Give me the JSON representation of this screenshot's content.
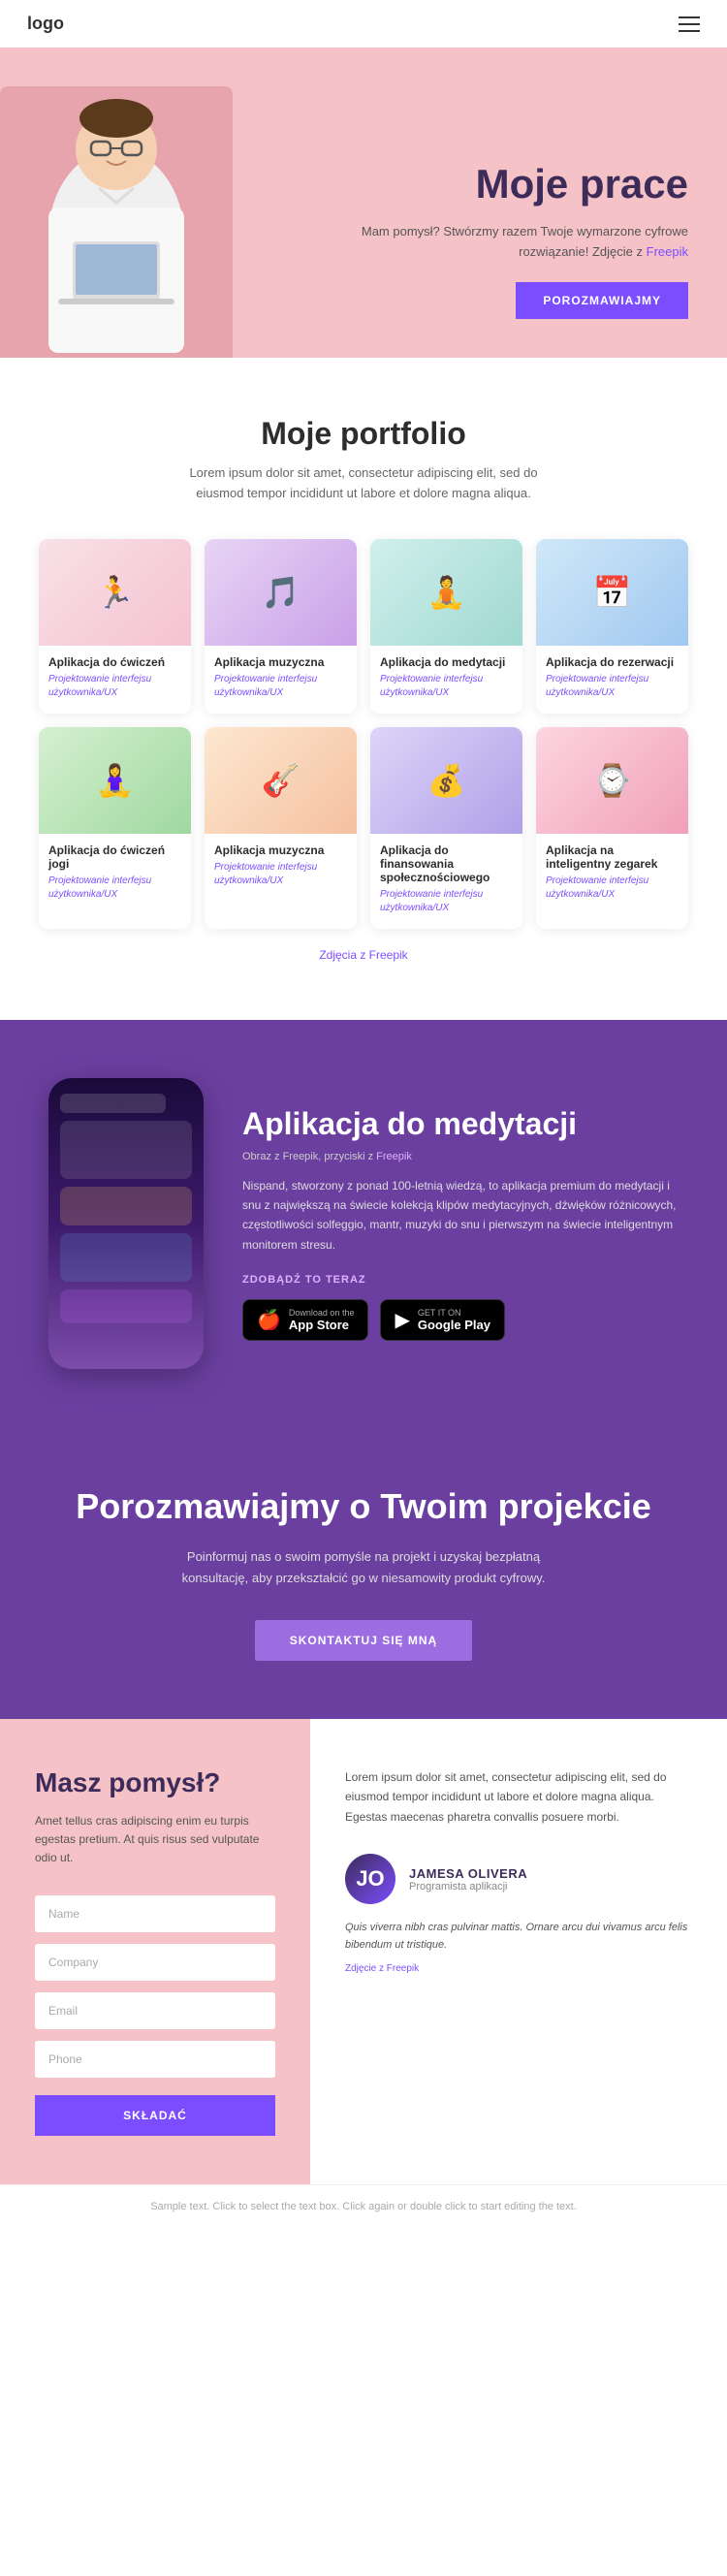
{
  "header": {
    "logo": "logo"
  },
  "hero": {
    "title": "Moje prace",
    "description": "Mam pomysł? Stwórzmy razem Twoje wymarzone cyfrowe rozwiązanie! Zdjęcie z",
    "freepik_link": "Freepik",
    "button_label": "POROZMAWIAJMY",
    "person_emoji": "👨‍💼"
  },
  "portfolio": {
    "title": "Moje portfolio",
    "description": "Lorem ipsum dolor sit amet, consectetur adipiscing elit, sed do eiusmod tempor incididunt ut labore et dolore magna aliqua.",
    "cards": [
      {
        "title": "Aplikacja do ćwiczeń",
        "subtitle": "Projektowanie interfejsu użytkownika/UX",
        "emoji": "🏃",
        "color_class": "card-pink"
      },
      {
        "title": "Aplikacja muzyczna",
        "subtitle": "Projektowanie interfejsu użytkownika/UX",
        "emoji": "🎵",
        "color_class": "card-purple"
      },
      {
        "title": "Aplikacja do medytacji",
        "subtitle": "Projektowanie interfejsu użytkownika/UX",
        "emoji": "🧘",
        "color_class": "card-teal"
      },
      {
        "title": "Aplikacja do rezerwacji",
        "subtitle": "Projektowanie interfejsu użytkownika/UX",
        "emoji": "📅",
        "color_class": "card-blue"
      },
      {
        "title": "Aplikacja do ćwiczeń jogi",
        "subtitle": "Projektowanie interfejsu użytkownika/UX",
        "emoji": "🧘‍♀️",
        "color_class": "card-green"
      },
      {
        "title": "Aplikacja muzyczna",
        "subtitle": "Projektowanie interfejsu użytkownika/UX",
        "emoji": "🎸",
        "color_class": "card-orange"
      },
      {
        "title": "Aplikacja do finansowania społecznościowego",
        "subtitle": "Projektowanie interfejsu użytkownika/UX",
        "emoji": "💰",
        "color_class": "card-indigo"
      },
      {
        "title": "Aplikacja na inteligentny zegarek",
        "subtitle": "Projektowanie interfejsu użytkownika/UX",
        "emoji": "⌚",
        "color_class": "card-rose"
      }
    ],
    "freepik_caption": "Zdjęcia z Freepik"
  },
  "meditation": {
    "title": "Aplikacja do medytacji",
    "image_caption": "Obraz z Freepik, przyciski z",
    "image_link": "Freepik",
    "description": "Nispand, stworzony z ponad 100-letnią wiedzą, to aplikacja premium do medytacji i snu z największą na świecie kolekcją klipów medytacyjnych, dźwięków różnicowych, częstotliwości solfeggio, mantr, muzyki do snu i pierwszym na świecie inteligentnym monitorem stresu.",
    "cta_label": "ZDOBĄDŹ TO TERAZ",
    "app_store_label": "App Store",
    "app_store_small": "Download on the",
    "google_play_label": "Google Play",
    "google_play_small": "GET IT ON"
  },
  "contact": {
    "title": "Porozmawiajmy o Twoim projekcie",
    "description": "Poinformuj nas o swoim pomyśle na projekt i uzyskaj bezpłatną konsultację, aby przekształcić go w niesamowity produkt cyfrowy.",
    "button_label": "SKONTAKTUJ SIĘ MNĄ"
  },
  "form": {
    "title": "Masz pomysł?",
    "description": "Amet tellus cras adipiscing enim eu turpis egestas pretium. At quis risus sed vulputate odio ut.",
    "name_placeholder": "Name",
    "company_placeholder": "Company",
    "email_placeholder": "Email",
    "phone_placeholder": "Phone",
    "submit_label": "SKŁADAĆ"
  },
  "testimonial": {
    "text": "Lorem ipsum dolor sit amet, consectetur adipiscing elit, sed do eiusmod tempor incididunt ut labore et dolore magna aliqua. Egestas maecenas pharetra convallis posuere morbi.",
    "name": "JAMESA OLIVERA",
    "role": "Programista aplikacji",
    "quote": "Quis viverra nibh cras pulvinar mattis. Ornare arcu dui vivamus arcu felis bibendum ut tristique.",
    "freepik_caption": "Zdjęcie z Freepik"
  },
  "footer": {
    "sample_text": "Sample text. Click to select the text box. Click again or double click to start editing the text."
  }
}
